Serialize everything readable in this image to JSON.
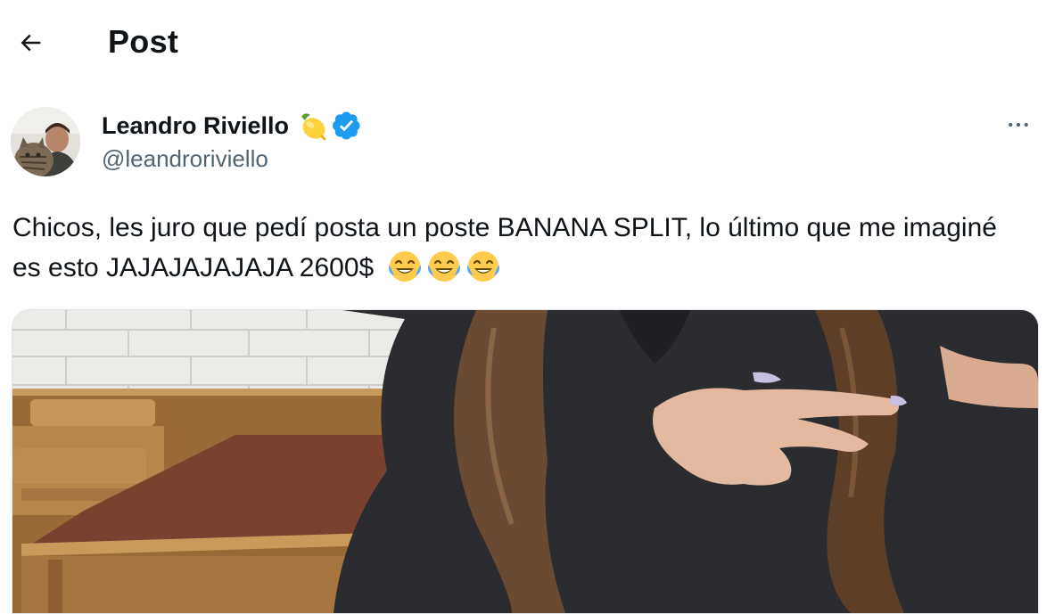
{
  "header": {
    "title": "Post",
    "back_icon": "arrow-left-icon"
  },
  "author": {
    "name": "Leandro Riviello",
    "handle": "@leandroriviello",
    "name_emoji": "lemon-icon",
    "verified_badge": "verified-badge-icon",
    "badge_color": "#1d9bf0"
  },
  "tweet": {
    "text": "Chicos, les juro que pedí posta un poste BANANA SPLIT, lo último que me imaginé es esto JAJAJAJAJAJA 2600$",
    "emojis": [
      "tears-of-joy-icon",
      "tears-of-joy-icon",
      "tears-of-joy-icon"
    ]
  },
  "more_menu_icon": "more-horizontal-icon",
  "colors": {
    "text": "#0f1419",
    "secondary": "#536471",
    "accent": "#1d9bf0"
  }
}
